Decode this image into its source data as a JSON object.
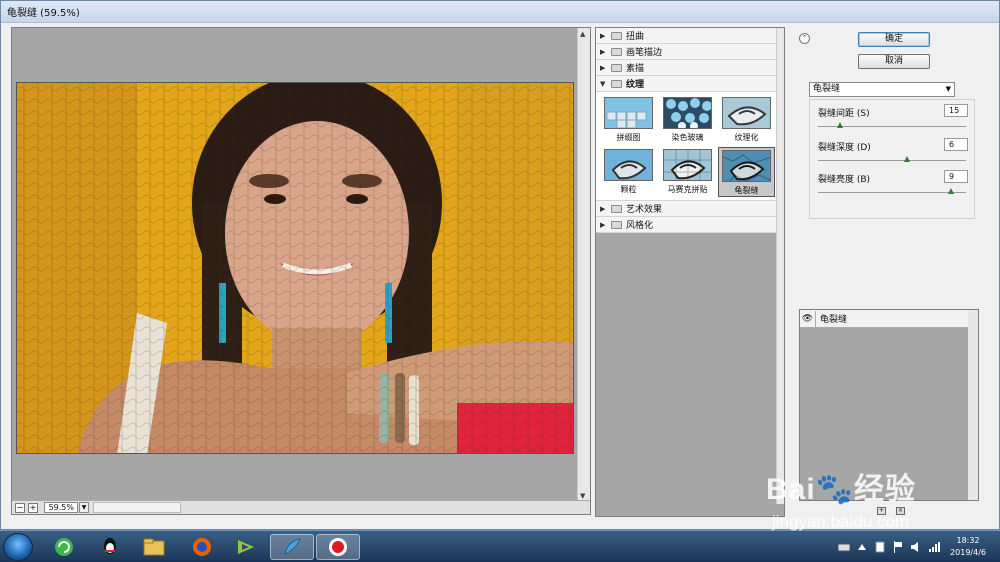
{
  "window": {
    "title": "龟裂缝 (59.5%)"
  },
  "preview": {
    "zoom_value": "59.5%",
    "zoom_out_label": "−",
    "zoom_in_label": "+"
  },
  "gallery": {
    "categories_top": [
      {
        "label": "扭曲",
        "expanded": false
      },
      {
        "label": "画笔描边",
        "expanded": false
      },
      {
        "label": "素描",
        "expanded": false
      },
      {
        "label": "纹理",
        "expanded": true
      }
    ],
    "thumbnails": [
      {
        "label": "拼缀图",
        "selected": false
      },
      {
        "label": "染色玻璃",
        "selected": false
      },
      {
        "label": "纹理化",
        "selected": false
      },
      {
        "label": "颗粒",
        "selected": false
      },
      {
        "label": "马赛克拼贴",
        "selected": false
      },
      {
        "label": "龟裂缝",
        "selected": true
      }
    ],
    "categories_bottom": [
      {
        "label": "艺术效果",
        "expanded": false
      },
      {
        "label": "风格化",
        "expanded": false
      }
    ]
  },
  "actions": {
    "ok_label": "确定",
    "cancel_label": "取消"
  },
  "filter_select": {
    "value": "龟裂缝"
  },
  "params": [
    {
      "label": "裂缝间距 (S)",
      "value": "15",
      "max": 100
    },
    {
      "label": "裂缝深度 (D)",
      "value": "6",
      "max": 10
    },
    {
      "label": "裂缝亮度 (B)",
      "value": "9",
      "max": 10
    }
  ],
  "layers": {
    "items": [
      {
        "name": "龟裂缝"
      }
    ]
  },
  "taskbar": {
    "apps": [
      "start-orb",
      "360-browser",
      "qq",
      "file-explorer",
      "firefox",
      "video-player",
      "feather-app",
      "screen-recorder"
    ],
    "time": "18:32",
    "date": "2019/4/6"
  },
  "watermark": {
    "brand": "Bai🐾经验",
    "site": "jingyan.baidu.com"
  },
  "colors": {
    "photo_bg": "#e3a51a",
    "accent_ok": "#3c7fb1",
    "taskbar": "#1b3656"
  }
}
